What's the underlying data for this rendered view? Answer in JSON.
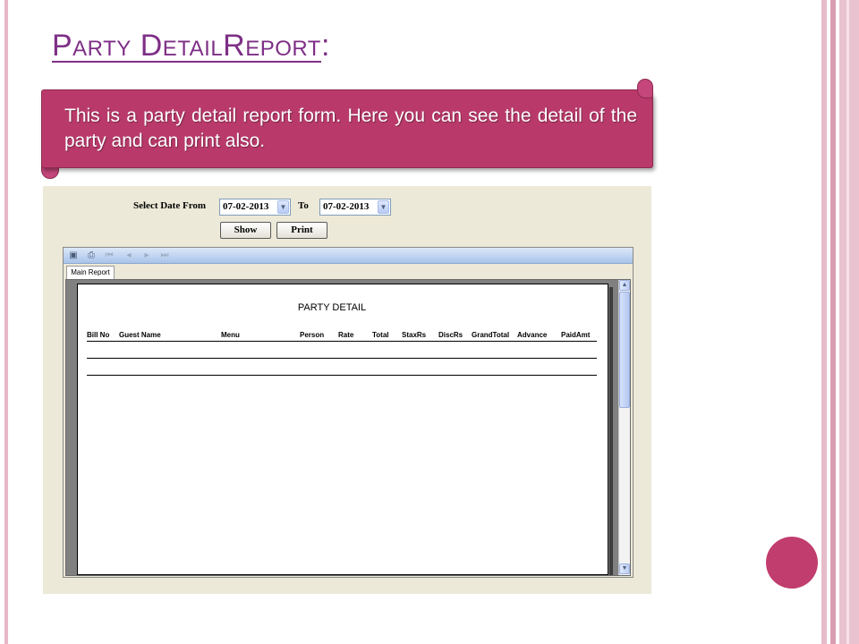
{
  "slide": {
    "title_main": "Party DetailReport",
    "title_suffix": ":",
    "banner_text": "This is a party detail report form. Here you can see the detail of the party and can print also.",
    "accent_color": "#b93a6a",
    "title_color": "#7e2f86"
  },
  "form": {
    "from_label": "Select Date From",
    "from_value": "07-02-2013",
    "to_label": "To",
    "to_value": "07-02-2013",
    "show_label": "Show",
    "print_label": "Print"
  },
  "viewer": {
    "toolbar_icons": [
      "export-icon",
      "print-icon",
      "first-page-icon",
      "previous-page-icon",
      "next-page-icon",
      "last-page-icon"
    ],
    "tab_label": "Main Report"
  },
  "report": {
    "title": "PARTY DETAIL",
    "columns": [
      "Bill No",
      "Guest Name",
      "Menu",
      "Person",
      "Rate",
      "Total",
      "StaxRs",
      "DiscRs",
      "GrandTotal",
      "Advance",
      "PaidAmt"
    ]
  }
}
